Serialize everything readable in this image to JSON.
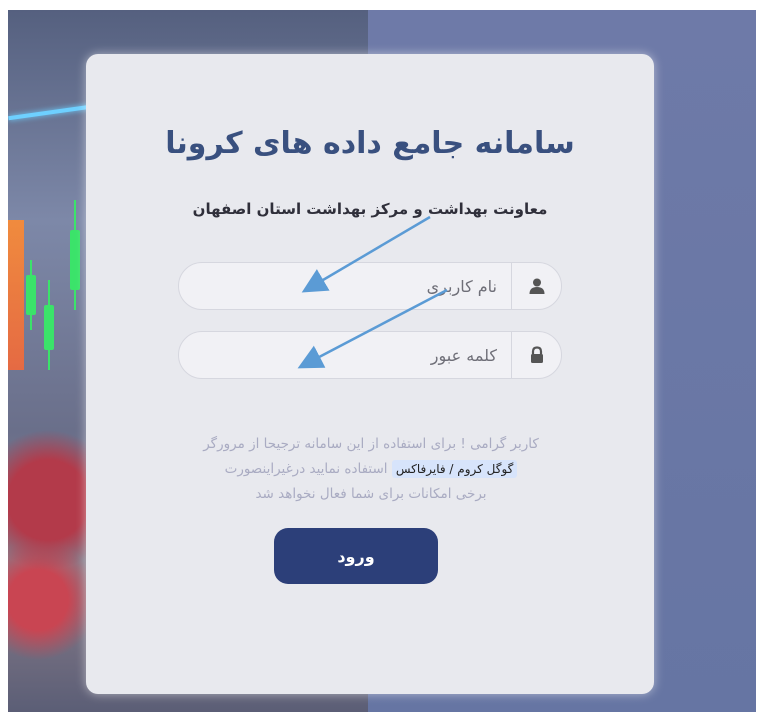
{
  "login": {
    "title": "سامانه جامع داده های کرونا",
    "subtitle": "معاونت بهداشت و مرکز بهداشت استان اصفهان",
    "username": {
      "placeholder": "نام کاربری",
      "value": "",
      "icon": "user-icon"
    },
    "password": {
      "placeholder": "کلمه عبور",
      "value": "",
      "icon": "lock-icon"
    },
    "notice": {
      "line1": "کاربر گرامی ! برای استفاده از این سامانه ترجیحا از مرورگر",
      "browsers": "گوگل کروم / فایرفاکس",
      "line2_rest": "استفاده نمایید درغیراینصورت",
      "line3": "برخی امکانات برای شما فعال نخواهد شد"
    },
    "submit_label": "ورود"
  },
  "colors": {
    "title": "#39507f",
    "button": "#2c3f79",
    "card": "#e8e9ee",
    "background": "#6b78a6",
    "annotation_arrow": "#5b9bd5"
  }
}
